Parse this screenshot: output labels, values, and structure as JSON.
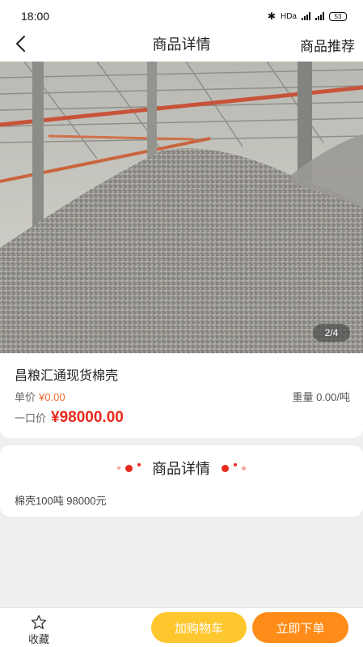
{
  "status_bar": {
    "time": "18:00",
    "network_label": "HDa",
    "signal1_label": "⁵⁶",
    "signal2_label": "⁴⁶",
    "battery": "53"
  },
  "nav": {
    "title": "商品详情",
    "right_action": "商品推荐"
  },
  "gallery": {
    "current_page": 2,
    "total_pages": 4,
    "indicator": "2/4"
  },
  "product": {
    "name": "昌粮汇通现货棉壳",
    "unit_price_label": "单价",
    "unit_price": "¥0.00",
    "weight_text": "重量 0.00/吨",
    "fixed_price_label": "一口价",
    "fixed_price": "¥98000.00"
  },
  "detail": {
    "title": "商品详情",
    "text": "棉壳100吨 98000元"
  },
  "bottom_bar": {
    "favorite_label": "收藏",
    "add_to_cart_label": "加购物车",
    "buy_now_label": "立即下单"
  },
  "colors": {
    "price_red": "#e8291c",
    "unit_orange": "#f0692c",
    "cart_yellow": "#ffc72e",
    "buy_orange": "#ff8c18"
  }
}
